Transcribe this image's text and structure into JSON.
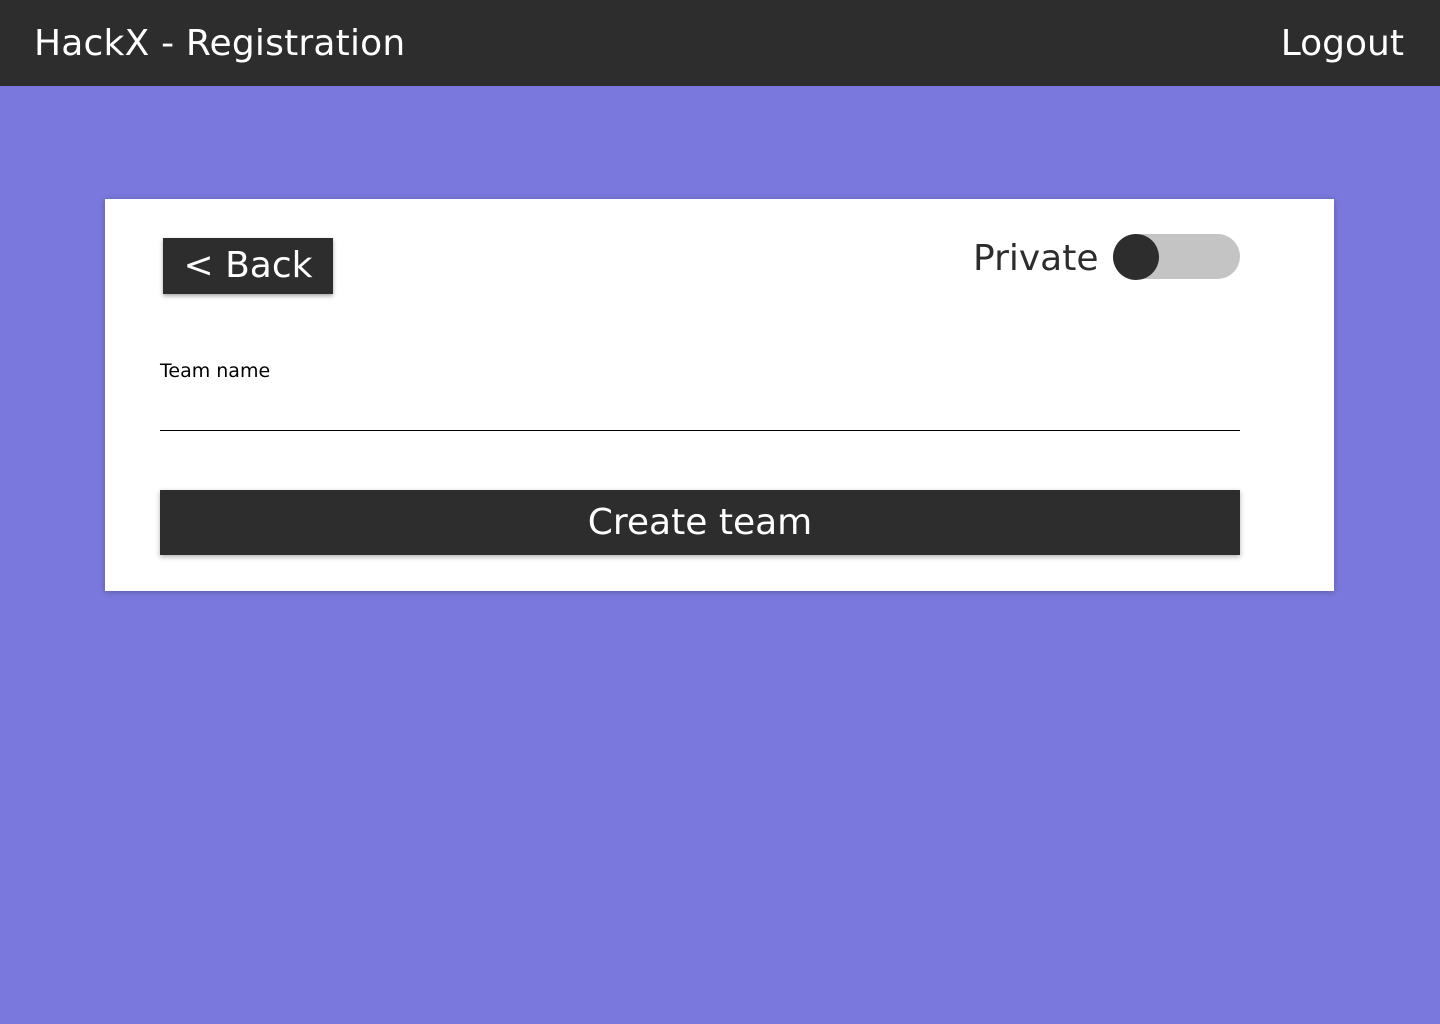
{
  "header": {
    "title": "HackX - Registration",
    "logout_label": "Logout"
  },
  "card": {
    "back_label": "< Back",
    "private_label": "Private",
    "private_toggle_on": false,
    "team_name_label": "Team name",
    "team_name_value": "",
    "create_label": "Create team"
  },
  "colors": {
    "background": "#7a78dc",
    "header": "#2d2d2d",
    "card": "#ffffff",
    "button": "#2d2d2d",
    "toggle_track": "#c4c4c4"
  }
}
